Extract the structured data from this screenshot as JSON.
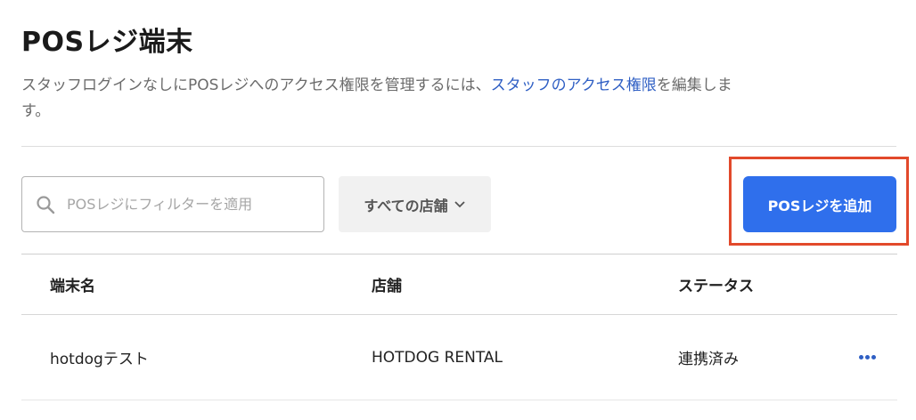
{
  "page": {
    "title": "POSレジ端末",
    "description_before": "スタッフログインなしにPOSレジへのアクセス権限を管理するには、",
    "description_link": "スタッフのアクセス権限",
    "description_after": "を編集します。"
  },
  "toolbar": {
    "search_placeholder": "POSレジにフィルターを適用",
    "search_icon": "search-icon",
    "store_filter_label": "すべての店舗",
    "store_filter_icon": "chevron-down-icon",
    "add_button_label": "POSレジを追加",
    "highlight_color": "#e2492b",
    "accent_color": "#2f6fec"
  },
  "table": {
    "columns": [
      "端末名",
      "店舗",
      "ステータス"
    ],
    "rows": [
      {
        "name": "hotdogテスト",
        "store": "HOTDOG RENTAL",
        "status": "連携済み",
        "action_icon": "more-horizontal-icon"
      }
    ]
  }
}
